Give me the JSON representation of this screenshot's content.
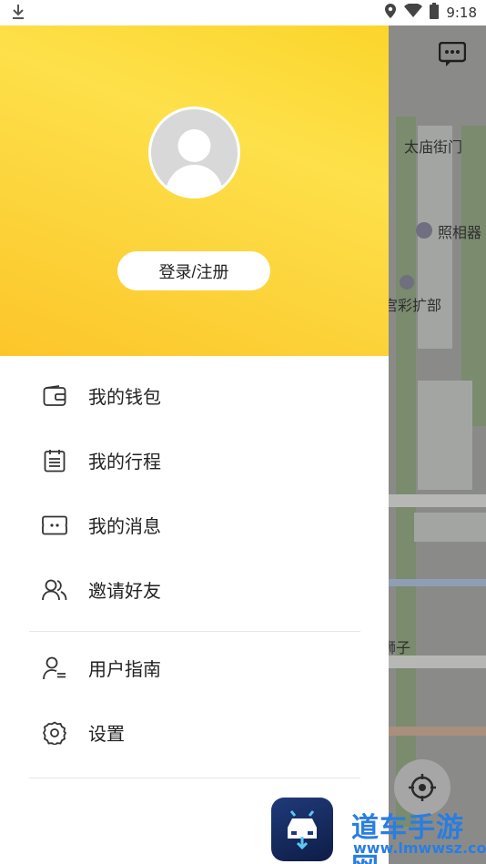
{
  "status_bar": {
    "time": "9:18"
  },
  "map": {
    "labels": [
      "太庙街门",
      "照相器",
      "宫彩扩部",
      "狮子"
    ]
  },
  "drawer": {
    "login_label": "登录/注册",
    "menu": [
      {
        "label": "我的钱包",
        "icon": "wallet-icon"
      },
      {
        "label": "我的行程",
        "icon": "itinerary-icon"
      },
      {
        "label": "我的消息",
        "icon": "message-icon"
      },
      {
        "label": "邀请好友",
        "icon": "invite-friends-icon"
      }
    ],
    "menu2": [
      {
        "label": "用户指南",
        "icon": "user-guide-icon"
      },
      {
        "label": "设置",
        "icon": "gear-icon"
      }
    ]
  },
  "watermark": {
    "title": "道车手游网",
    "url": "www.lmwwsz.com"
  },
  "colors": {
    "header_yellow": "#fcd52b",
    "accent_blue": "#2a7de1"
  }
}
